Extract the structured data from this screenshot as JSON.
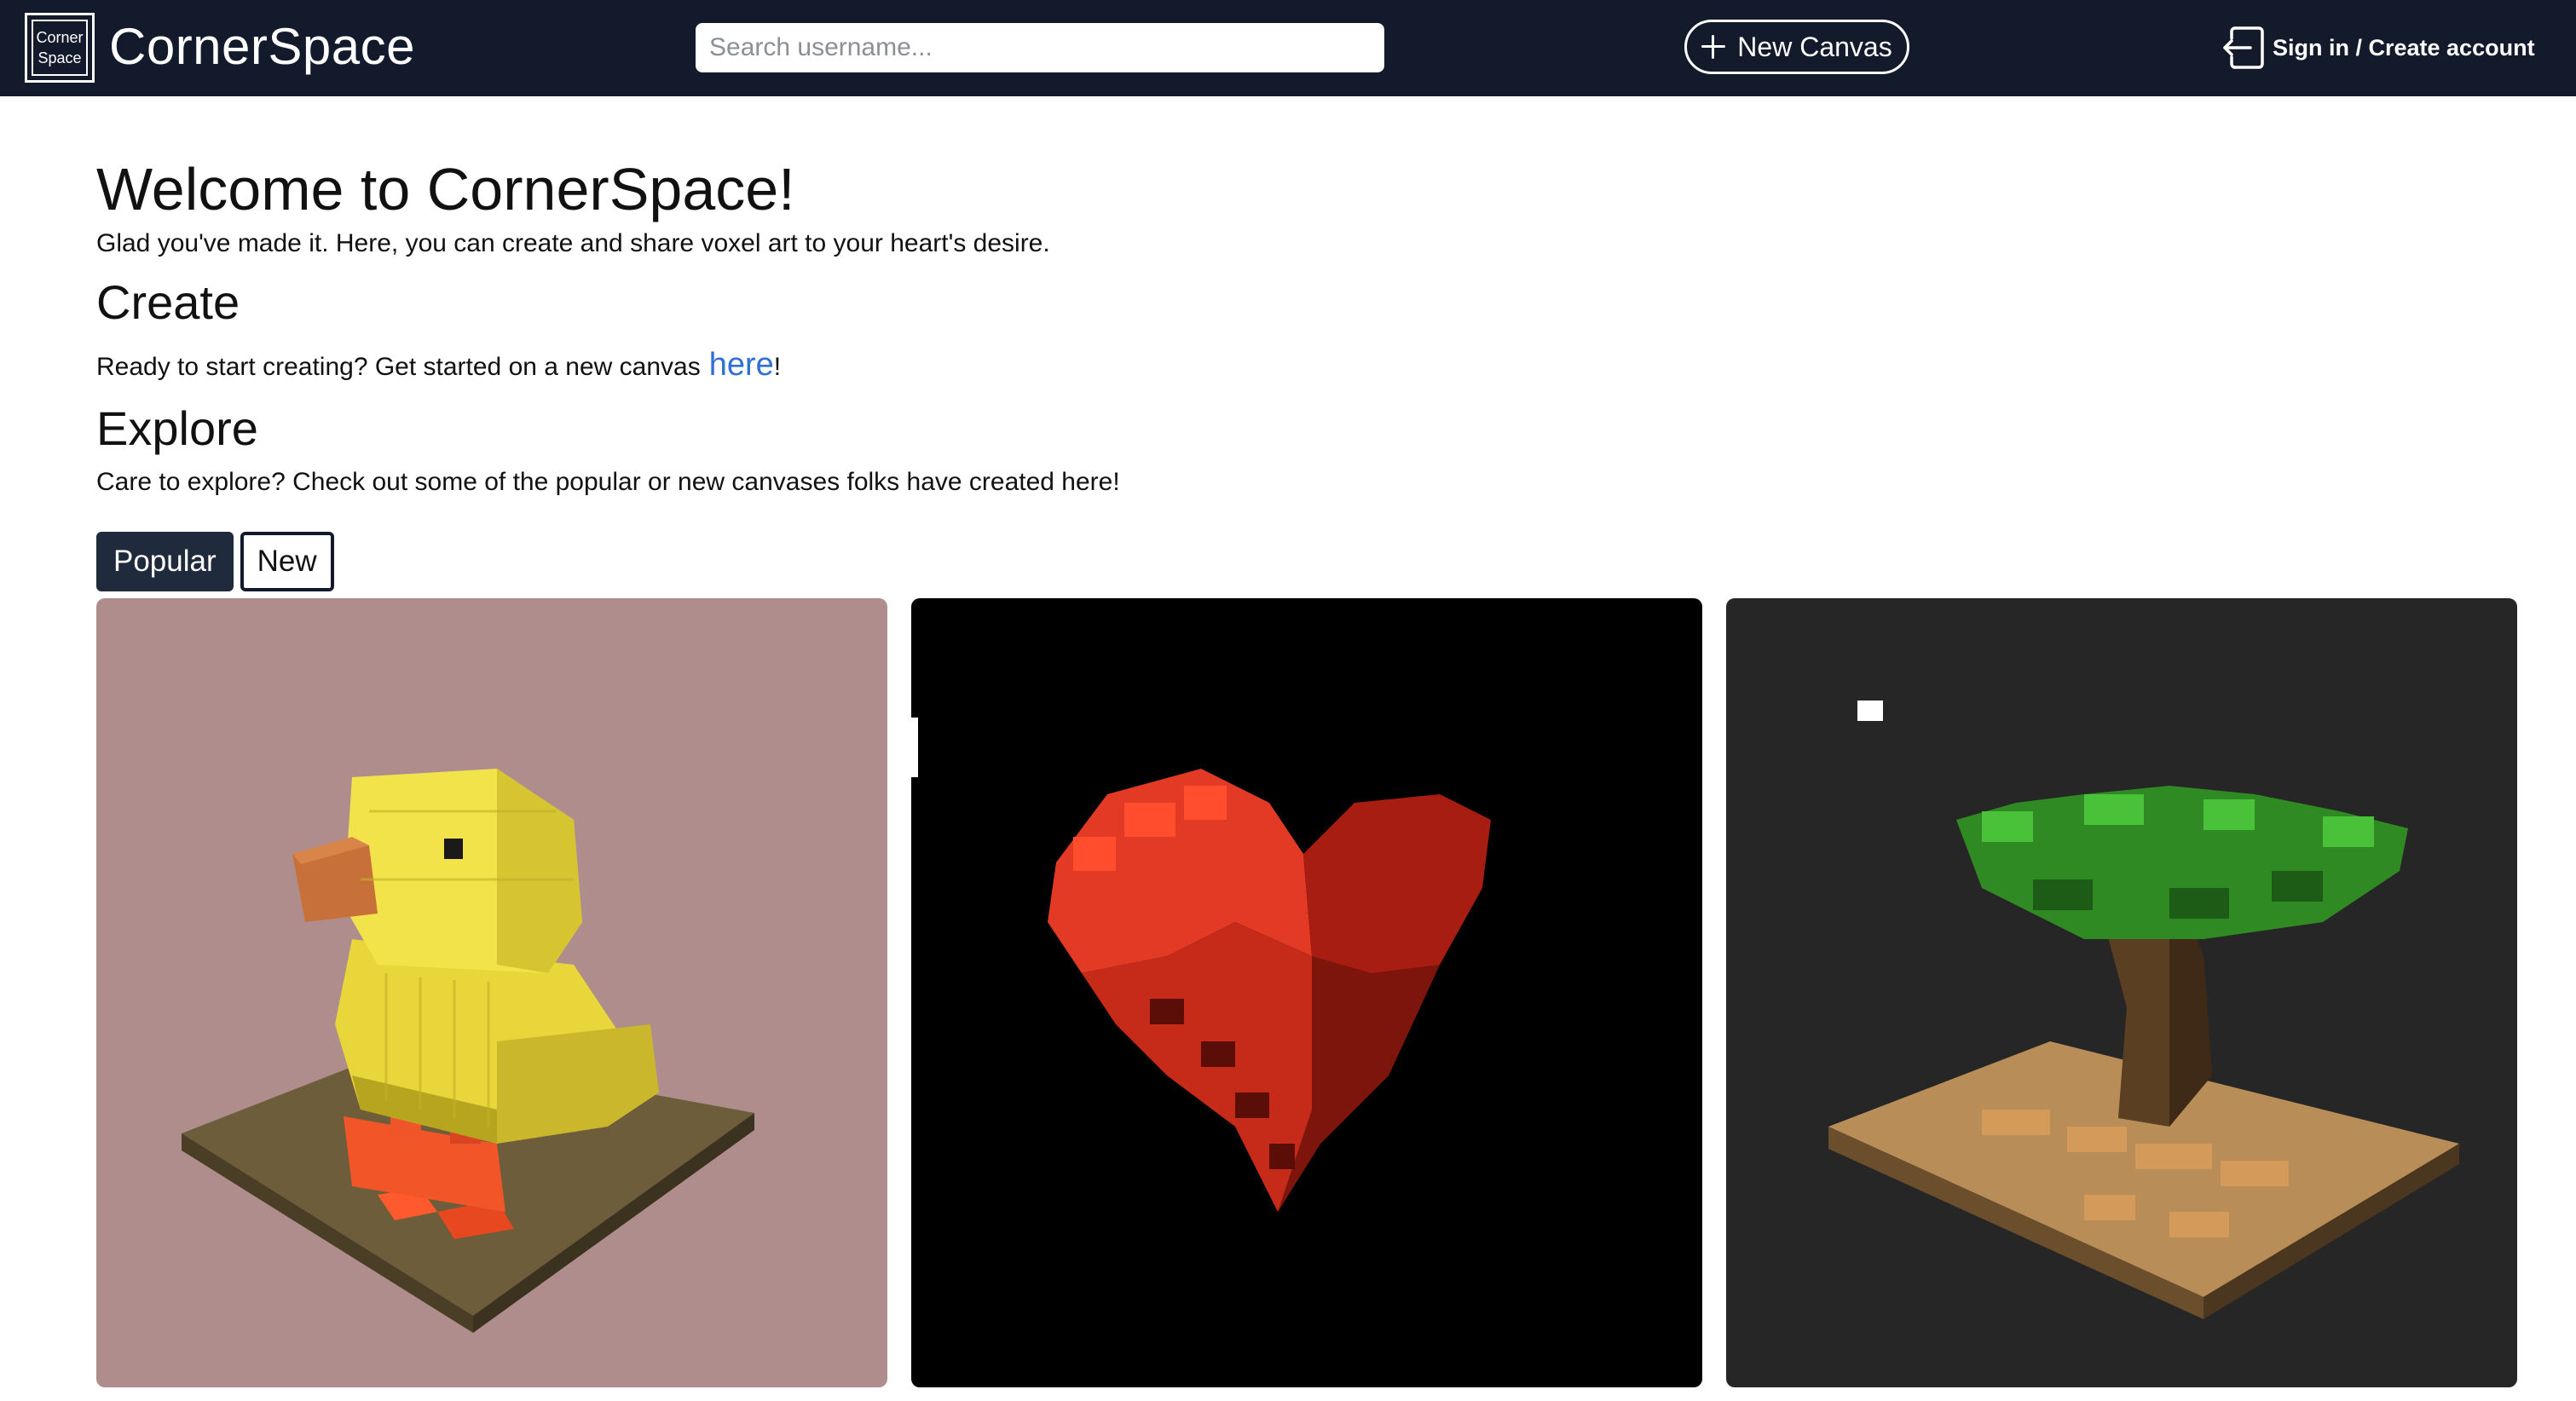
{
  "header": {
    "logo_line1": "Corner",
    "logo_line2": "Space",
    "brand": "CornerSpace",
    "search_placeholder": "Search username...",
    "new_canvas_label": "New Canvas",
    "signin_label": "Sign in / Create account"
  },
  "main": {
    "welcome_title": "Welcome to CornerSpace!",
    "welcome_text": "Glad you've made it. Here, you can create and share voxel art to your heart's desire.",
    "create_heading": "Create",
    "create_text": "Ready to start creating? Get started on a new canvas",
    "create_link": "here",
    "create_suffix": "!",
    "explore_heading": "Explore",
    "explore_text": "Care to explore? Check out some of the popular or new canvases folks have created here!",
    "tabs": [
      {
        "label": "Popular",
        "active": true
      },
      {
        "label": "New",
        "active": false
      }
    ]
  },
  "gallery": {
    "cards": [
      {
        "subject": "voxel duck",
        "background": "#b08d8d"
      },
      {
        "subject": "voxel heart",
        "background": "#000000"
      },
      {
        "subject": "voxel tree",
        "background": "#262626"
      }
    ]
  },
  "colors": {
    "topbar": "#121a2b",
    "link": "#2f6fd6",
    "tab_active": "#1f2a3d"
  }
}
